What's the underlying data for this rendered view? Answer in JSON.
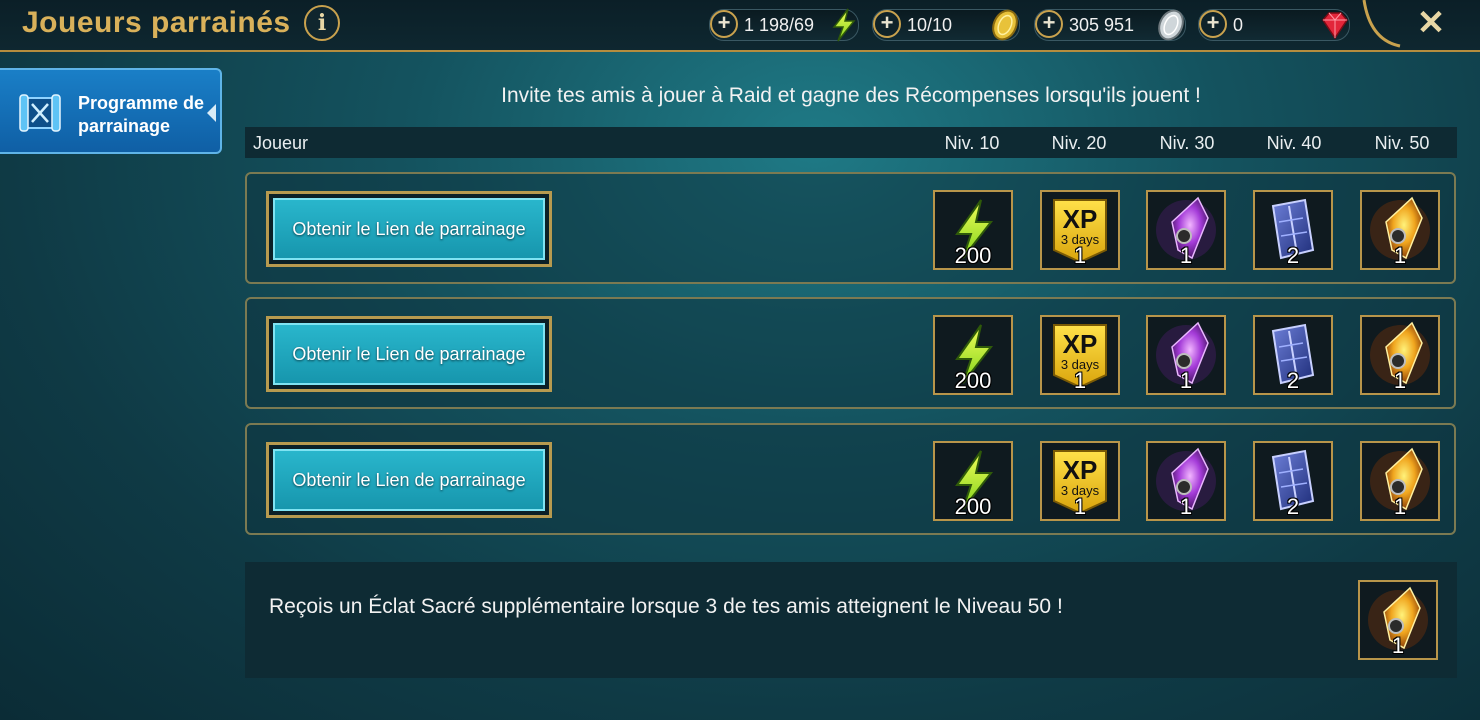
{
  "header": {
    "title": "Joueurs parrainés",
    "info_icon": "info-icon",
    "close_icon": "close-icon"
  },
  "resources": [
    {
      "name": "energy",
      "value": "1 198/69",
      "icon": "energy-bolt-icon"
    },
    {
      "name": "arena-token",
      "value": "10/10",
      "icon": "gold-coin-icon"
    },
    {
      "name": "silver",
      "value": "305 951",
      "icon": "silver-coin-icon"
    },
    {
      "name": "gems",
      "value": "0",
      "icon": "ruby-gem-icon"
    }
  ],
  "sidebar": {
    "items": [
      {
        "label": "Programme de parrainage",
        "icon": "scroll-icon",
        "active": true
      }
    ]
  },
  "main": {
    "headline": "Invite tes amis à jouer à Raid et gagne des Récompenses lorsqu'ils jouent !",
    "columns": {
      "player": "Joueur",
      "levels": [
        "Niv. 10",
        "Niv. 20",
        "Niv. 30",
        "Niv. 40",
        "Niv. 50"
      ]
    },
    "rows": [
      {
        "button_label": "Obtenir le Lien de parrainage",
        "rewards": [
          {
            "icon": "energy-icon",
            "qty": "200"
          },
          {
            "icon": "xp-boost-icon",
            "label": "XP",
            "sub": "3 days",
            "qty": "1"
          },
          {
            "icon": "void-shard-icon",
            "qty": "1"
          },
          {
            "icon": "tome-icon",
            "qty": "2"
          },
          {
            "icon": "sacred-shard-icon",
            "qty": "1"
          }
        ]
      },
      {
        "button_label": "Obtenir le Lien de parrainage",
        "rewards": [
          {
            "icon": "energy-icon",
            "qty": "200"
          },
          {
            "icon": "xp-boost-icon",
            "label": "XP",
            "sub": "3 days",
            "qty": "1"
          },
          {
            "icon": "void-shard-icon",
            "qty": "1"
          },
          {
            "icon": "tome-icon",
            "qty": "2"
          },
          {
            "icon": "sacred-shard-icon",
            "qty": "1"
          }
        ]
      },
      {
        "button_label": "Obtenir le Lien de parrainage",
        "rewards": [
          {
            "icon": "energy-icon",
            "qty": "200"
          },
          {
            "icon": "xp-boost-icon",
            "label": "XP",
            "sub": "3 days",
            "qty": "1"
          },
          {
            "icon": "void-shard-icon",
            "qty": "1"
          },
          {
            "icon": "tome-icon",
            "qty": "2"
          },
          {
            "icon": "sacred-shard-icon",
            "qty": "1"
          }
        ]
      }
    ],
    "bonus": {
      "text": "Reçois un Éclat Sacré supplémentaire lorsque 3 de tes amis atteignent le Niveau 50 !",
      "reward": {
        "icon": "sacred-shard-icon",
        "qty": "1"
      }
    }
  },
  "colors": {
    "gold_accent": "#c9a24e",
    "button_cyan": "#1fa7be",
    "tab_blue": "#1576bf",
    "background": "#14535f"
  }
}
